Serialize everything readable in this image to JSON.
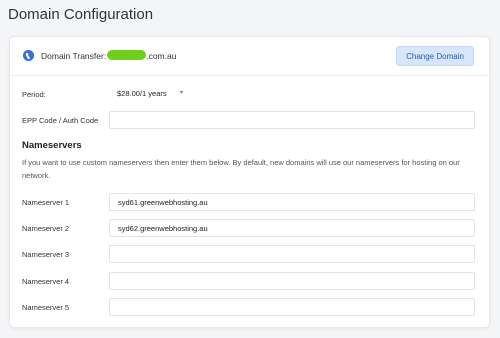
{
  "page": {
    "title": "Domain Configuration"
  },
  "domain": {
    "transfer_label": "Domain Transfer:",
    "domain_suffix": ".com.au",
    "change_button": "Change Domain",
    "mask_color": "#6fcf1a"
  },
  "period": {
    "label": "Period:",
    "value": "$28.00/1 years"
  },
  "epp": {
    "label": "EPP Code / Auth Code",
    "value": ""
  },
  "nameservers": {
    "title": "Nameservers",
    "description": "If you want to use custom nameservers then enter them below. By default, new domains will use our nameservers for hosting on our network.",
    "fields": [
      {
        "label": "Nameserver 1",
        "value": "syd61.greenwebhosting.au"
      },
      {
        "label": "Nameserver 2",
        "value": "syd62.greenwebhosting.au"
      },
      {
        "label": "Nameserver 3",
        "value": ""
      },
      {
        "label": "Nameserver 4",
        "value": ""
      },
      {
        "label": "Nameserver 5",
        "value": ""
      }
    ]
  },
  "colors": {
    "accent": "#3b6fd4",
    "button_bg": "#d6e6fb",
    "button_text": "#2a5ea8"
  }
}
